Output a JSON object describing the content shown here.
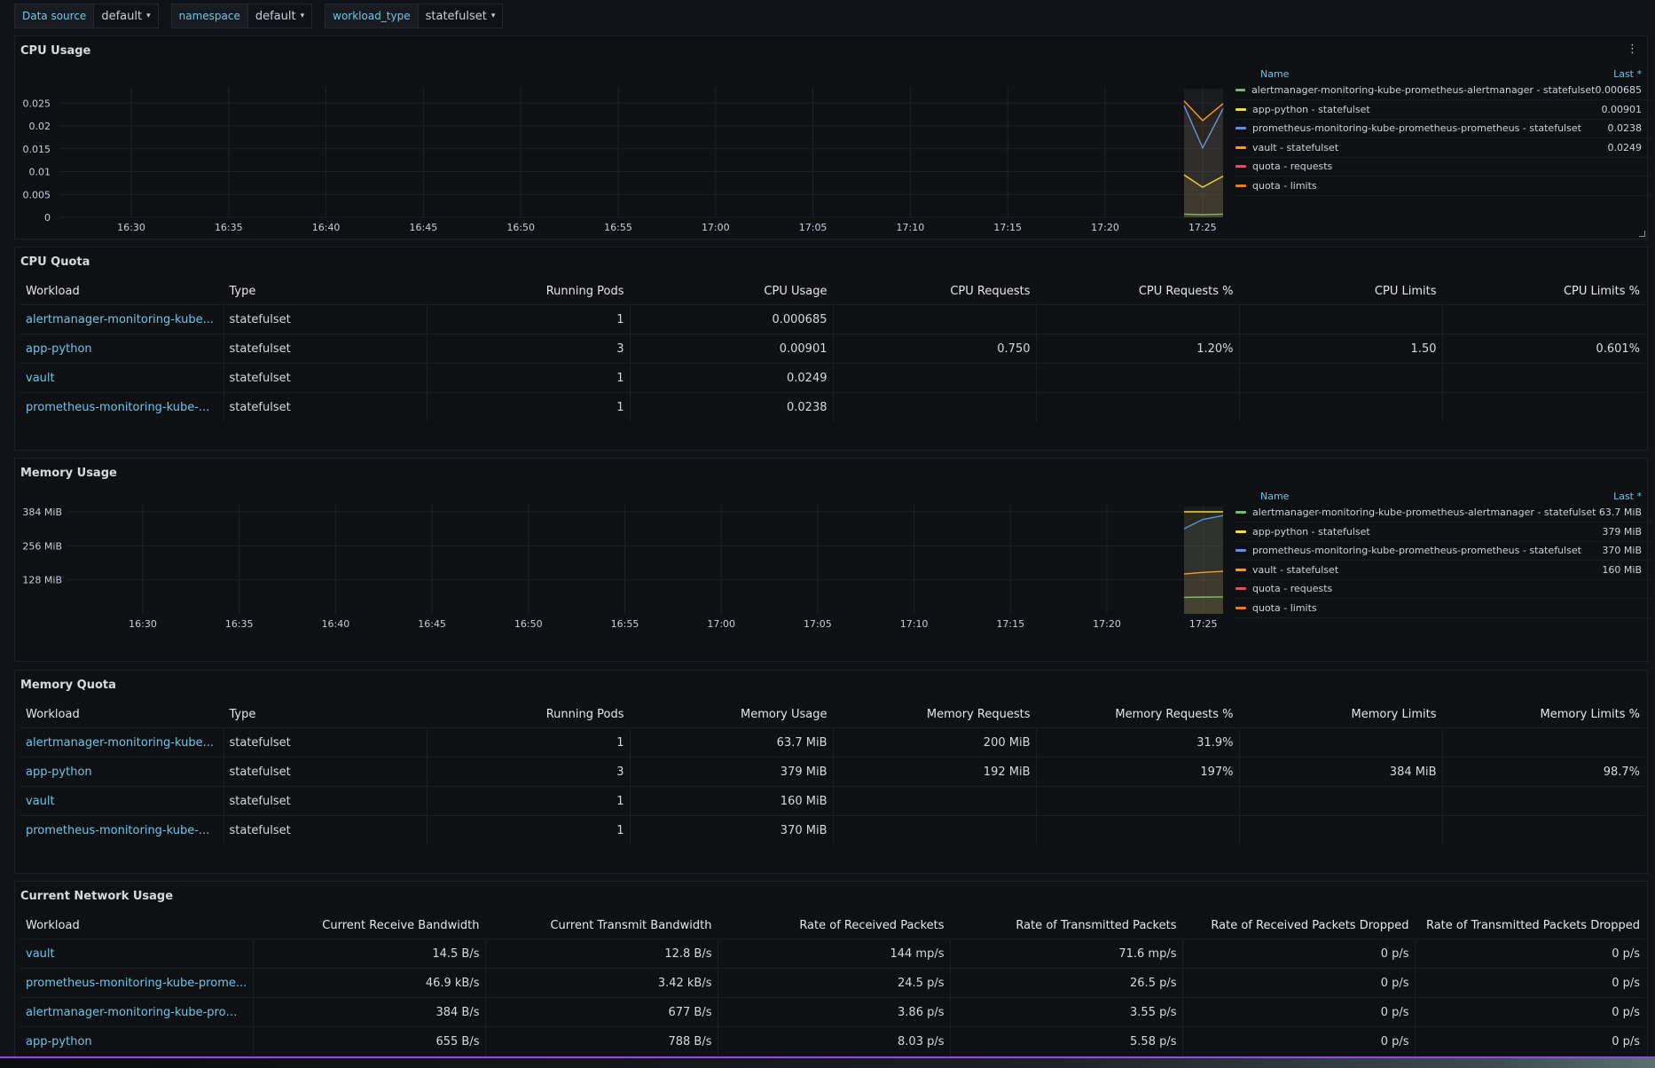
{
  "variables": [
    {
      "label": "Data source",
      "value": "default"
    },
    {
      "label": "namespace",
      "value": "default"
    },
    {
      "label": "workload_type",
      "value": "statefulset"
    }
  ],
  "cpu_usage": {
    "title": "CPU Usage",
    "legend_header": {
      "name": "Name",
      "last": "Last *"
    },
    "legend": [
      {
        "name": "alertmanager-monitoring-kube-prometheus-alertmanager - statefulset",
        "last": "0.000685",
        "color": "#73bf69"
      },
      {
        "name": "app-python - statefulset",
        "last": "0.00901",
        "color": "#fade2a"
      },
      {
        "name": "prometheus-monitoring-kube-prometheus-prometheus - statefulset",
        "last": "0.0238",
        "color": "#5794f2"
      },
      {
        "name": "vault - statefulset",
        "last": "0.0249",
        "color": "#ff9830"
      },
      {
        "name": "quota - requests",
        "last": "",
        "color": "#f2495c"
      },
      {
        "name": "quota - limits",
        "last": "",
        "color": "#ff780a"
      }
    ]
  },
  "memory_usage": {
    "title": "Memory Usage",
    "legend_header": {
      "name": "Name",
      "last": "Last *"
    },
    "legend": [
      {
        "name": "alertmanager-monitoring-kube-prometheus-alertmanager - statefulset",
        "last": "63.7 MiB",
        "color": "#73bf69"
      },
      {
        "name": "app-python - statefulset",
        "last": "379 MiB",
        "color": "#fade2a"
      },
      {
        "name": "prometheus-monitoring-kube-prometheus-prometheus - statefulset",
        "last": "370 MiB",
        "color": "#5794f2"
      },
      {
        "name": "vault - statefulset",
        "last": "160 MiB",
        "color": "#ff9830"
      },
      {
        "name": "quota - requests",
        "last": "",
        "color": "#f2495c"
      },
      {
        "name": "quota - limits",
        "last": "",
        "color": "#ff780a"
      }
    ]
  },
  "cpu_quota": {
    "title": "CPU Quota",
    "headers": [
      "Workload",
      "Type",
      "Running Pods",
      "CPU Usage",
      "CPU Requests",
      "CPU Requests %",
      "CPU Limits",
      "CPU Limits %"
    ],
    "rows": [
      [
        "alertmanager-monitoring-kube...",
        "statefulset",
        "1",
        "0.000685",
        "",
        "",
        "",
        ""
      ],
      [
        "app-python",
        "statefulset",
        "3",
        "0.00901",
        "0.750",
        "1.20%",
        "1.50",
        "0.601%"
      ],
      [
        "vault",
        "statefulset",
        "1",
        "0.0249",
        "",
        "",
        "",
        ""
      ],
      [
        "prometheus-monitoring-kube-...",
        "statefulset",
        "1",
        "0.0238",
        "",
        "",
        "",
        ""
      ]
    ]
  },
  "memory_quota": {
    "title": "Memory Quota",
    "headers": [
      "Workload",
      "Type",
      "Running Pods",
      "Memory Usage",
      "Memory Requests",
      "Memory Requests %",
      "Memory Limits",
      "Memory Limits %"
    ],
    "rows": [
      [
        "alertmanager-monitoring-kube...",
        "statefulset",
        "1",
        "63.7 MiB",
        "200 MiB",
        "31.9%",
        "",
        ""
      ],
      [
        "app-python",
        "statefulset",
        "3",
        "379 MiB",
        "192 MiB",
        "197%",
        "384 MiB",
        "98.7%"
      ],
      [
        "vault",
        "statefulset",
        "1",
        "160 MiB",
        "",
        "",
        "",
        ""
      ],
      [
        "prometheus-monitoring-kube-...",
        "statefulset",
        "1",
        "370 MiB",
        "",
        "",
        "",
        ""
      ]
    ]
  },
  "network": {
    "title": "Current Network Usage",
    "headers": [
      "Workload",
      "Current Receive Bandwidth",
      "Current Transmit Bandwidth",
      "Rate of Received Packets",
      "Rate of Transmitted Packets",
      "Rate of Received Packets Dropped",
      "Rate of Transmitted Packets Dropped"
    ],
    "rows": [
      [
        "vault",
        "14.5 B/s",
        "12.8 B/s",
        "144 mp/s",
        "71.6 mp/s",
        "0 p/s",
        "0 p/s"
      ],
      [
        "prometheus-monitoring-kube-prome...",
        "46.9 kB/s",
        "3.42 kB/s",
        "24.5 p/s",
        "26.5 p/s",
        "0 p/s",
        "0 p/s"
      ],
      [
        "alertmanager-monitoring-kube-prom...",
        "384 B/s",
        "677 B/s",
        "3.86 p/s",
        "3.55 p/s",
        "0 p/s",
        "0 p/s"
      ],
      [
        "app-python",
        "655 B/s",
        "788 B/s",
        "8.03 p/s",
        "5.58 p/s",
        "0 p/s",
        "0 p/s"
      ]
    ]
  },
  "chart_data": [
    {
      "type": "line",
      "title": "CPU Usage",
      "x_ticks": [
        "16:30",
        "16:35",
        "16:40",
        "16:45",
        "16:50",
        "16:55",
        "17:00",
        "17:05",
        "17:10",
        "17:15",
        "17:20",
        "17:25"
      ],
      "y_ticks": [
        "0",
        "0.005",
        "0.01",
        "0.015",
        "0.02",
        "0.025"
      ],
      "ylim": [
        0,
        0.027
      ],
      "x_points": [
        "17:24",
        "17:25",
        "17:26"
      ],
      "series": [
        {
          "name": "alertmanager-monitoring-kube-prometheus-alertmanager - statefulset",
          "values": [
            0.0007,
            0.0006,
            0.000685
          ],
          "color": "#73bf69"
        },
        {
          "name": "app-python - statefulset",
          "values": [
            0.0093,
            0.0066,
            0.00901
          ],
          "color": "#fade2a"
        },
        {
          "name": "prometheus-monitoring-kube-prometheus-prometheus - statefulset",
          "values": [
            0.0245,
            0.0152,
            0.0238
          ],
          "color": "#5794f2"
        },
        {
          "name": "vault - statefulset",
          "values": [
            0.0255,
            0.0212,
            0.0249
          ],
          "color": "#ff9830"
        }
      ]
    },
    {
      "type": "line",
      "title": "Memory Usage",
      "x_ticks": [
        "16:30",
        "16:35",
        "16:40",
        "16:45",
        "16:50",
        "16:55",
        "17:00",
        "17:05",
        "17:10",
        "17:15",
        "17:20",
        "17:25"
      ],
      "y_ticks": [
        "128 MiB",
        "256 MiB",
        "384 MiB"
      ],
      "y_tick_values": [
        128,
        256,
        384
      ],
      "ylim": [
        0,
        384
      ],
      "x_points": [
        "17:24",
        "17:25",
        "17:26"
      ],
      "series": [
        {
          "name": "alertmanager-monitoring-kube-prometheus-alertmanager - statefulset",
          "values": [
            62,
            63,
            63.7
          ],
          "color": "#73bf69"
        },
        {
          "name": "app-python - statefulset",
          "values": [
            384,
            384,
            384
          ],
          "color": "#fade2a"
        },
        {
          "name": "prometheus-monitoring-kube-prometheus-prometheus - statefulset",
          "values": [
            320,
            355,
            370
          ],
          "color": "#5794f2"
        },
        {
          "name": "vault - statefulset",
          "values": [
            150,
            156,
            160
          ],
          "color": "#ff9830"
        }
      ]
    }
  ]
}
